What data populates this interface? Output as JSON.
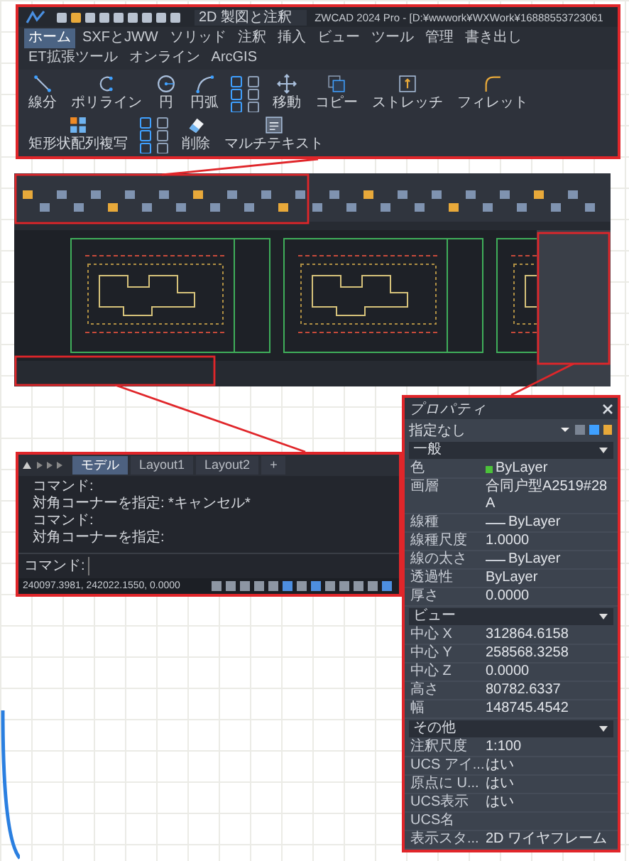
{
  "ribbon": {
    "workspace": "2D 製図と注釈",
    "title": "ZWCAD 2024 Pro - [D:¥wwwork¥WXWork¥16888553723061",
    "tabs": [
      {
        "label": "ホーム",
        "selected": true
      },
      {
        "label": "SXFとJWW",
        "selected": false
      },
      {
        "label": "ソリッド",
        "selected": false
      },
      {
        "label": "注釈",
        "selected": false
      },
      {
        "label": "挿入",
        "selected": false
      },
      {
        "label": "ビュー",
        "selected": false
      },
      {
        "label": "ツール",
        "selected": false
      },
      {
        "label": "管理",
        "selected": false
      },
      {
        "label": "書き出し",
        "selected": false
      },
      {
        "label": "ET拡張ツール",
        "selected": false
      },
      {
        "label": "オンライン",
        "selected": false
      },
      {
        "label": "ArcGIS",
        "selected": false
      }
    ],
    "tools": [
      {
        "label": "線分",
        "kind": "line"
      },
      {
        "label": "ポリライン",
        "kind": "polyline"
      },
      {
        "label": "円",
        "kind": "circle"
      },
      {
        "label": "円弧",
        "kind": "arc"
      },
      {
        "label": "移動",
        "kind": "move"
      },
      {
        "label": "コピー",
        "kind": "copy"
      },
      {
        "label": "ストレッチ",
        "kind": "stretch"
      },
      {
        "label": "フィレット",
        "kind": "fillet"
      },
      {
        "label": "矩形状配列複写",
        "kind": "array"
      },
      {
        "label": "削除",
        "kind": "erase"
      },
      {
        "label": "マルチテキスト",
        "kind": "mtext"
      }
    ]
  },
  "command_panel": {
    "tabs": [
      {
        "label": "モデル",
        "selected": true
      },
      {
        "label": "Layout1",
        "selected": false
      },
      {
        "label": "Layout2",
        "selected": false
      },
      {
        "label": "+",
        "selected": false
      }
    ],
    "history": [
      "コマンド:",
      "対角コーナーを指定: *キャンセル*",
      "コマンド:",
      "対角コーナーを指定:"
    ],
    "prompt": "コマンド:",
    "coordinates": "240097.3981, 242022.1550, 0.0000"
  },
  "properties": {
    "title": "プロパティ",
    "selection": "指定なし",
    "sections": [
      {
        "title": "一般",
        "expanded": true,
        "rows": [
          {
            "label": "色",
            "value": "ByLayer",
            "kind": "color",
            "color": "#4cc23a"
          },
          {
            "label": "画層",
            "value": "合同户型A2519#28A",
            "kind": "text"
          },
          {
            "label": "線種",
            "value": "ByLayer",
            "kind": "linetype"
          },
          {
            "label": "線種尺度",
            "value": "1.0000",
            "kind": "text"
          },
          {
            "label": "線の太さ",
            "value": "ByLayer",
            "kind": "linetype"
          },
          {
            "label": "透過性",
            "value": "ByLayer",
            "kind": "text"
          },
          {
            "label": "厚さ",
            "value": "0.0000",
            "kind": "text"
          }
        ]
      },
      {
        "title": "ビュー",
        "expanded": true,
        "rows": [
          {
            "label": "中心 X",
            "value": "312864.6158",
            "kind": "text"
          },
          {
            "label": "中心 Y",
            "value": "258568.3258",
            "kind": "text"
          },
          {
            "label": "中心 Z",
            "value": "0.0000",
            "kind": "text"
          },
          {
            "label": "高さ",
            "value": "80782.6337",
            "kind": "text"
          },
          {
            "label": "幅",
            "value": "148745.4542",
            "kind": "text"
          }
        ]
      },
      {
        "title": "その他",
        "expanded": true,
        "rows": [
          {
            "label": "注釈尺度",
            "value": "1:100",
            "kind": "text"
          },
          {
            "label": "UCS アイ...",
            "value": "はい",
            "kind": "text"
          },
          {
            "label": "原点に U...",
            "value": "はい",
            "kind": "text"
          },
          {
            "label": "UCS表示",
            "value": "はい",
            "kind": "text"
          },
          {
            "label": "UCS名",
            "value": "",
            "kind": "text"
          },
          {
            "label": "表示スタ...",
            "value": "2D ワイヤフレーム",
            "kind": "text"
          }
        ]
      }
    ]
  }
}
